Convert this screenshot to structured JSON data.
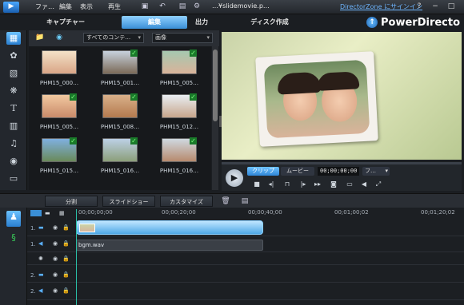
{
  "menu": [
    "ファ…",
    "編集",
    "表示",
    "再生"
  ],
  "filename": "…¥slidemovie.p…",
  "directorzone": "DirectorZone にサインイン",
  "window_buttons": [
    "?",
    "−",
    "□"
  ],
  "tabs": [
    {
      "label": "キャプチャー",
      "active": false
    },
    {
      "label": "編集",
      "active": true
    },
    {
      "label": "出力",
      "active": false
    },
    {
      "label": "ディスク作成",
      "active": false
    }
  ],
  "brand": "PowerDirecto",
  "library": {
    "filter": "すべてのコンテ…",
    "type": "画像"
  },
  "thumbnails": [
    {
      "label": "PHM15_000…",
      "checked": false
    },
    {
      "label": "PHM15_001…",
      "checked": true
    },
    {
      "label": "PHM15_005…",
      "checked": true
    },
    {
      "label": "PHM15_005…",
      "checked": true
    },
    {
      "label": "PHM15_008…",
      "checked": true
    },
    {
      "label": "PHM15_012…",
      "checked": true
    },
    {
      "label": "PHM15_015…",
      "checked": true
    },
    {
      "label": "PHM15_016…",
      "checked": true
    },
    {
      "label": "PHM15_016…",
      "checked": true
    }
  ],
  "transport": {
    "clip": "クリップ",
    "movie": "ムービー",
    "timecode": "00;00;00;00",
    "mode": "フ…"
  },
  "mid_buttons": [
    "分割",
    "スライドショー",
    "カスタマイズ"
  ],
  "ruler": [
    "00;00;00;00",
    "00;00;20;00",
    "00;00;40;00",
    "00;01;00;02",
    "00;01;20;02"
  ],
  "tracks": [
    {
      "name": "1."
    },
    {
      "name": "1."
    },
    {
      "name": "2."
    },
    {
      "name": "2."
    }
  ],
  "audio_clip": "bgm.wav",
  "colors": {
    "accent": "#3a8fd6",
    "bg": "#1b1e22",
    "clip": "#4ea8e6",
    "check": "#1a7a2a"
  }
}
